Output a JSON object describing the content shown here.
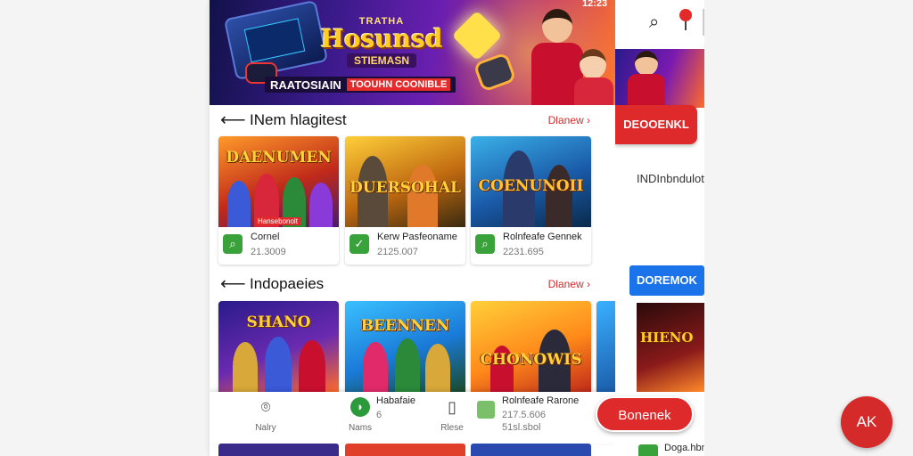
{
  "colors": {
    "accent": "#de2a2a",
    "link": "#d62c2c",
    "blue": "#1a73e8",
    "app_icon": "#3aa23a"
  },
  "banner": {
    "time": "12:23",
    "top_text": "TRATHA",
    "title": "Hosunsd",
    "subtitle": "STIEMASN",
    "strip_left": "RAATOSIAIN",
    "strip_right": "TOOUHN COONIBLE"
  },
  "section1": {
    "title": "INem hlagitest",
    "link": "Dlanew ›",
    "cards": [
      {
        "thumb_title": "DAENUMEN",
        "tag": "Hansebonolt",
        "name": "Cornel",
        "count": "21.3009",
        "icon": "search-icon"
      },
      {
        "thumb_title": "DUERSOHAL",
        "name": "Kerw Pasfeoname",
        "count": "2125.007",
        "icon": "check-icon"
      },
      {
        "thumb_title": "COENUNOII",
        "name": "Rolnfeafe Gennek",
        "count": "2231.695",
        "icon": "search-icon"
      }
    ]
  },
  "section2": {
    "title": "Indopaeies",
    "link": "Dlanew ›",
    "cards": [
      {
        "thumb_title": "SHANO"
      },
      {
        "thumb_title": "BEENNEN"
      },
      {
        "thumb_title": "CHONOWIS"
      }
    ]
  },
  "bottom_nav": {
    "items": [
      {
        "icon": "camera-icon",
        "label": "Nalry"
      },
      {
        "icon": "gamepad-icon",
        "label": "Nams"
      },
      {
        "icon": "tablet-icon",
        "label": "Rlese"
      }
    ],
    "promo1": {
      "title": "Habafaie",
      "sub": "6"
    },
    "promo2": {
      "title": "Rolnfeafe Rarone",
      "sub": "217.5.606",
      "extra": "51sl.sbol"
    }
  },
  "side": {
    "red_button": "DEOOENKL",
    "text": "INDInbndulot",
    "blue_button": "DOREMOK",
    "thumb_title": "HIENO",
    "bottom_text": "Doga.hbn"
  },
  "float_button": "Bonenek",
  "fab": "AK"
}
